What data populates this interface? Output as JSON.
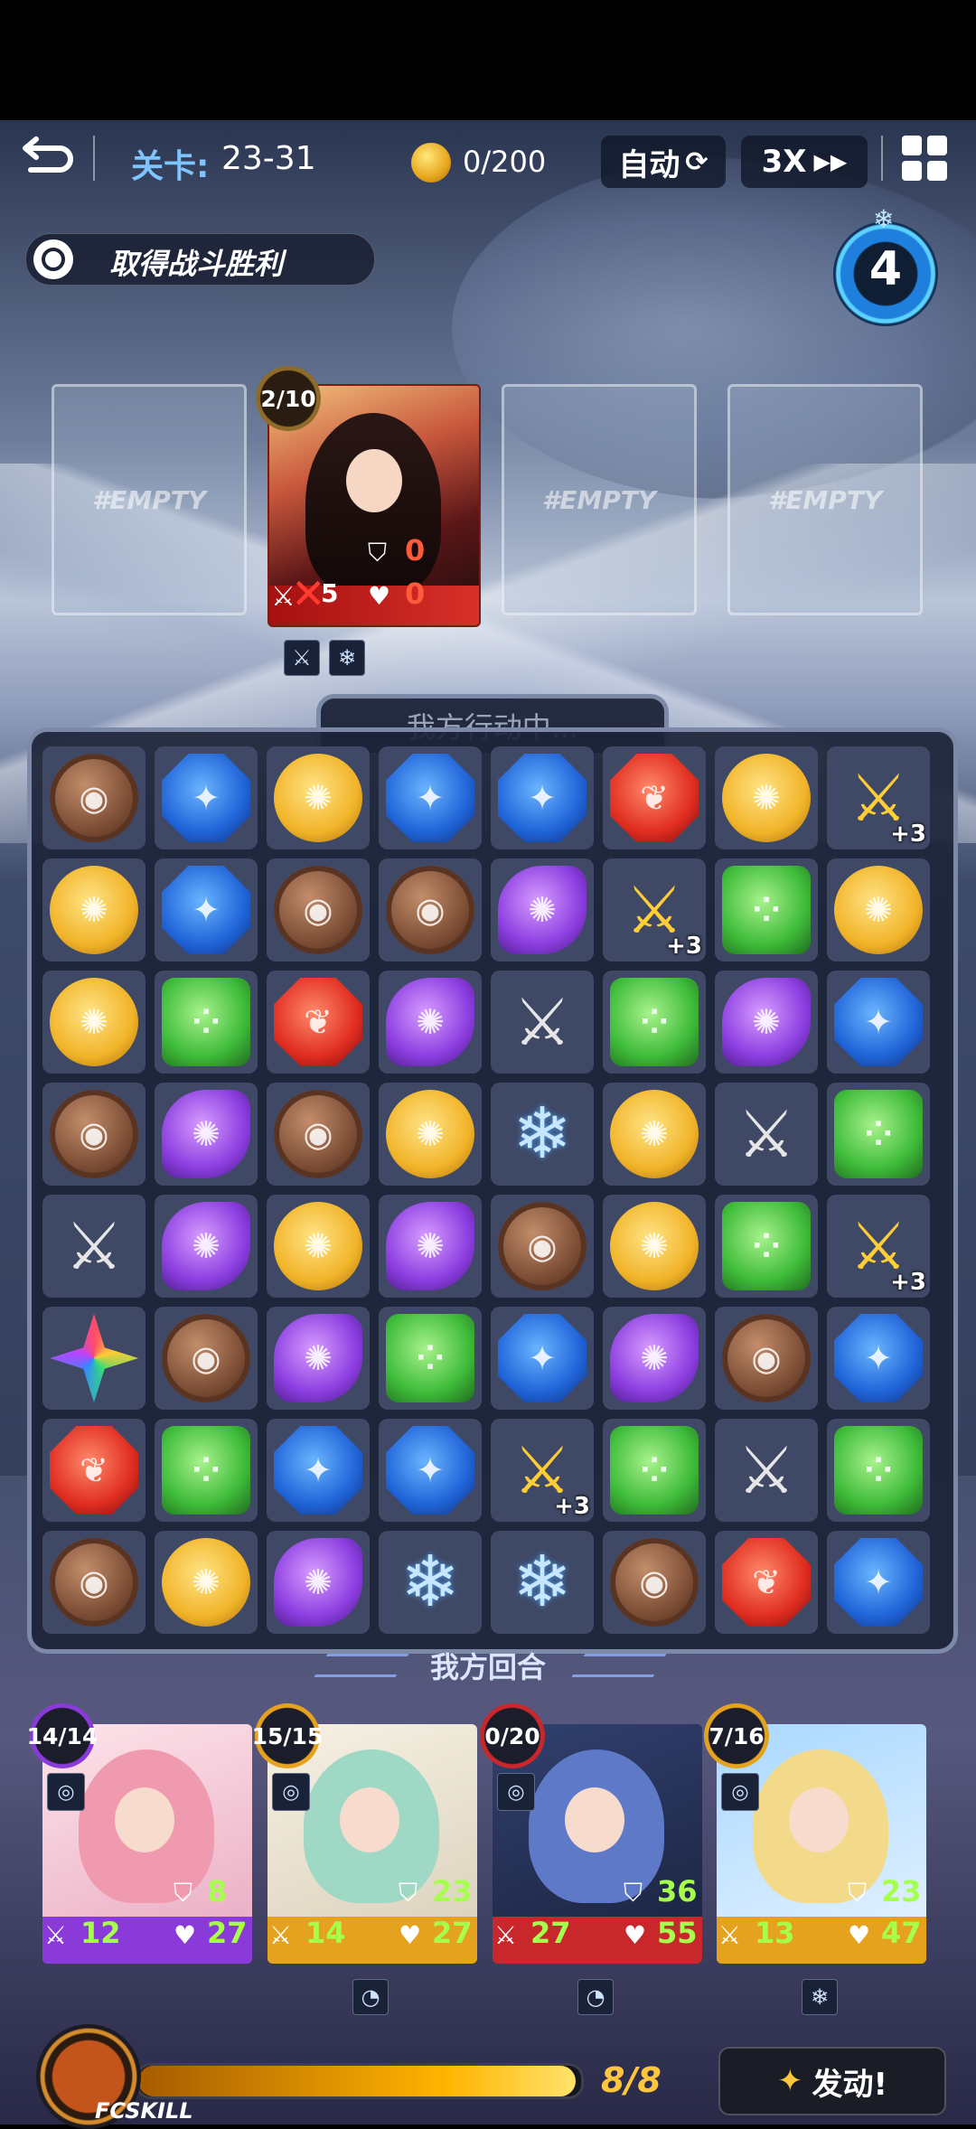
{
  "header": {
    "level_label": "关卡:",
    "level_value": "23-31",
    "coins": "0/200",
    "auto_label": "自动",
    "auto_icon": "refresh-icon",
    "speed_label": "3X",
    "speed_icon": "fast-forward-icon",
    "menu_icon": "grid-menu-icon"
  },
  "objective": {
    "text": "取得战斗胜利",
    "icon": "target-icon"
  },
  "turn_counter": {
    "value": "4",
    "icon": "snowflake-icon"
  },
  "enemies": {
    "empty_label": "#EMPTY",
    "boss": {
      "charge": "2/10",
      "shield": "0",
      "hp": "0",
      "attack": "5"
    },
    "status_icons": [
      "sword-icon",
      "snowflake-icon"
    ]
  },
  "board": {
    "status_text": "我方行动中...",
    "round_label": "我方回合",
    "rows": [
      [
        "brown",
        "blue",
        "gold",
        "blue",
        "blue",
        "red",
        "gold",
        "sword-gold+3"
      ],
      [
        "gold",
        "blue",
        "brown",
        "brown",
        "purple",
        "sword-gold+3",
        "green",
        "gold"
      ],
      [
        "gold",
        "green",
        "red",
        "purple",
        "sword",
        "green",
        "purple",
        "blue"
      ],
      [
        "brown",
        "purple",
        "brown",
        "gold",
        "ice",
        "gold",
        "sword",
        "green"
      ],
      [
        "sword",
        "purple",
        "gold",
        "purple",
        "brown",
        "gold",
        "green",
        "sword-gold+3"
      ],
      [
        "rainbow",
        "brown",
        "purple",
        "green",
        "blue",
        "purple",
        "brown",
        "blue"
      ],
      [
        "red",
        "green",
        "blue",
        "blue",
        "sword-gold+3",
        "green",
        "sword",
        "green"
      ],
      [
        "brown",
        "gold",
        "purple",
        "ice",
        "ice",
        "brown",
        "red",
        "blue"
      ]
    ]
  },
  "heroes": [
    {
      "charge": "14/14",
      "shield": "8",
      "attack": "12",
      "hp": "27",
      "element_color": "#8a3ad8",
      "below_icon": ""
    },
    {
      "charge": "15/15",
      "shield": "23",
      "attack": "14",
      "hp": "27",
      "element_color": "#e5a21e",
      "below_icon": "bear-icon"
    },
    {
      "charge": "0/20",
      "shield": "36",
      "attack": "27",
      "hp": "55",
      "element_color": "#c8282c",
      "below_icon": "bear-icon"
    },
    {
      "charge": "7/16",
      "shield": "23",
      "attack": "13",
      "hp": "47",
      "element_color": "#e5a21e",
      "below_icon": "snowflake-icon"
    }
  ],
  "skill": {
    "label": "FCSKILL",
    "count": "8/8",
    "progress": 1.0,
    "activate_label": "发动!",
    "activate_icon": "magic-wand-icon"
  }
}
